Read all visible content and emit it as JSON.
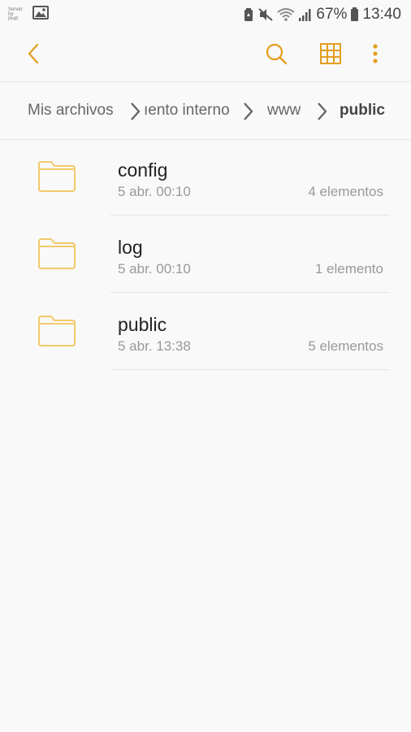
{
  "status_bar": {
    "left_tiny": "Server for PHP",
    "battery_pct": "67%",
    "time": "13:40"
  },
  "toolbar": {
    "accent": "#e39e1f",
    "back_icon": "chevron-left-icon",
    "search_icon": "search-icon",
    "grid_icon": "grid-view-icon",
    "more_icon": "more-vert-icon"
  },
  "breadcrumb": {
    "items": [
      "Mis archivos",
      "ıento interno",
      "www",
      "public"
    ]
  },
  "folders": [
    {
      "name": "config",
      "date": "5 abr. 00:10",
      "count": "4 elementos"
    },
    {
      "name": "log",
      "date": "5 abr. 00:10",
      "count": "1 elemento"
    },
    {
      "name": "public",
      "date": "5 abr. 13:38",
      "count": "5 elementos"
    }
  ]
}
